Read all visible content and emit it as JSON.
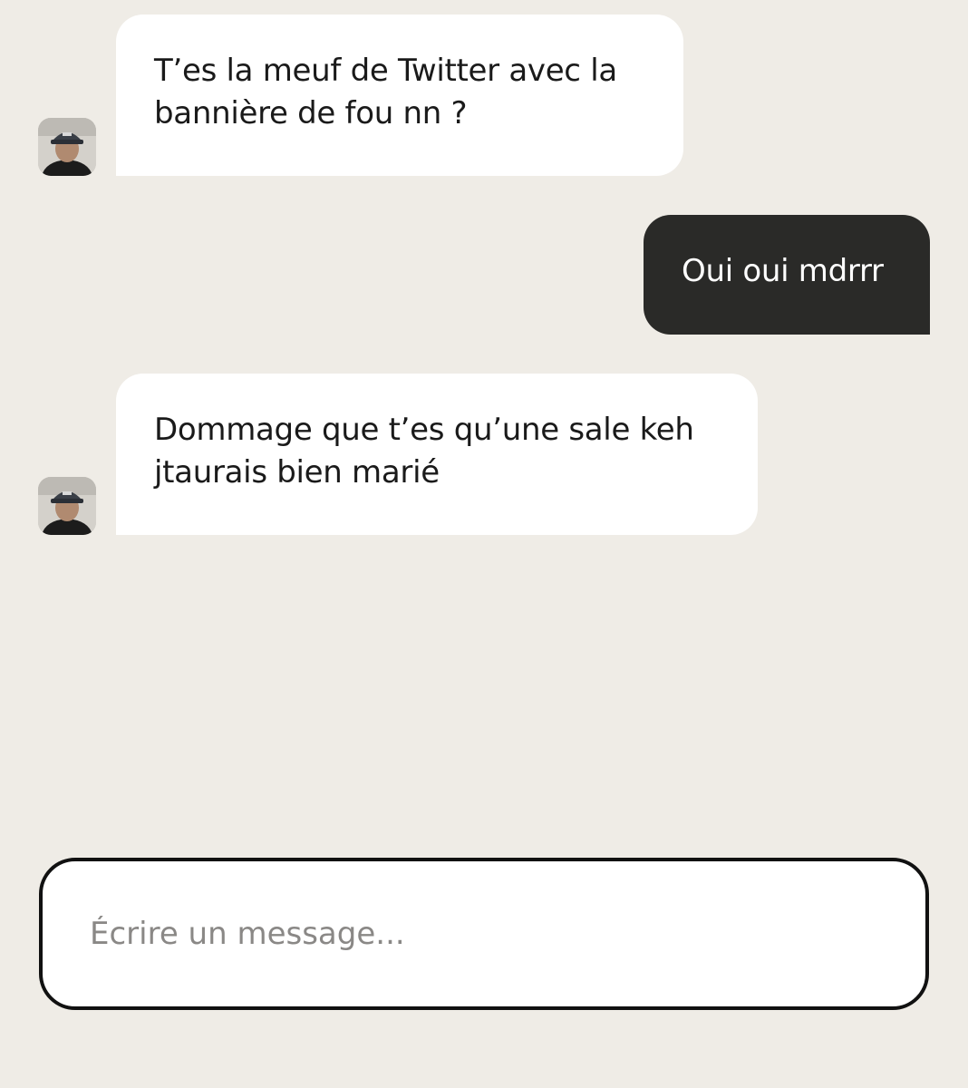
{
  "conversation": {
    "messages": [
      {
        "direction": "incoming",
        "text": "T’es la meuf de Twitter avec la\nbannière de fou nn ?"
      },
      {
        "direction": "outgoing",
        "text": "Oui oui mdrrr"
      },
      {
        "direction": "incoming",
        "text": "Dommage que t’es qu’une sale keh\njtaurais bien marié"
      }
    ]
  },
  "composer": {
    "placeholder": "Écrire un message...",
    "value": ""
  },
  "colors": {
    "background": "#EFECE6",
    "incoming_bubble": "#FFFFFF",
    "outgoing_bubble": "#2A2A28",
    "composer_border": "#111111",
    "placeholder_text": "#8A8886"
  }
}
